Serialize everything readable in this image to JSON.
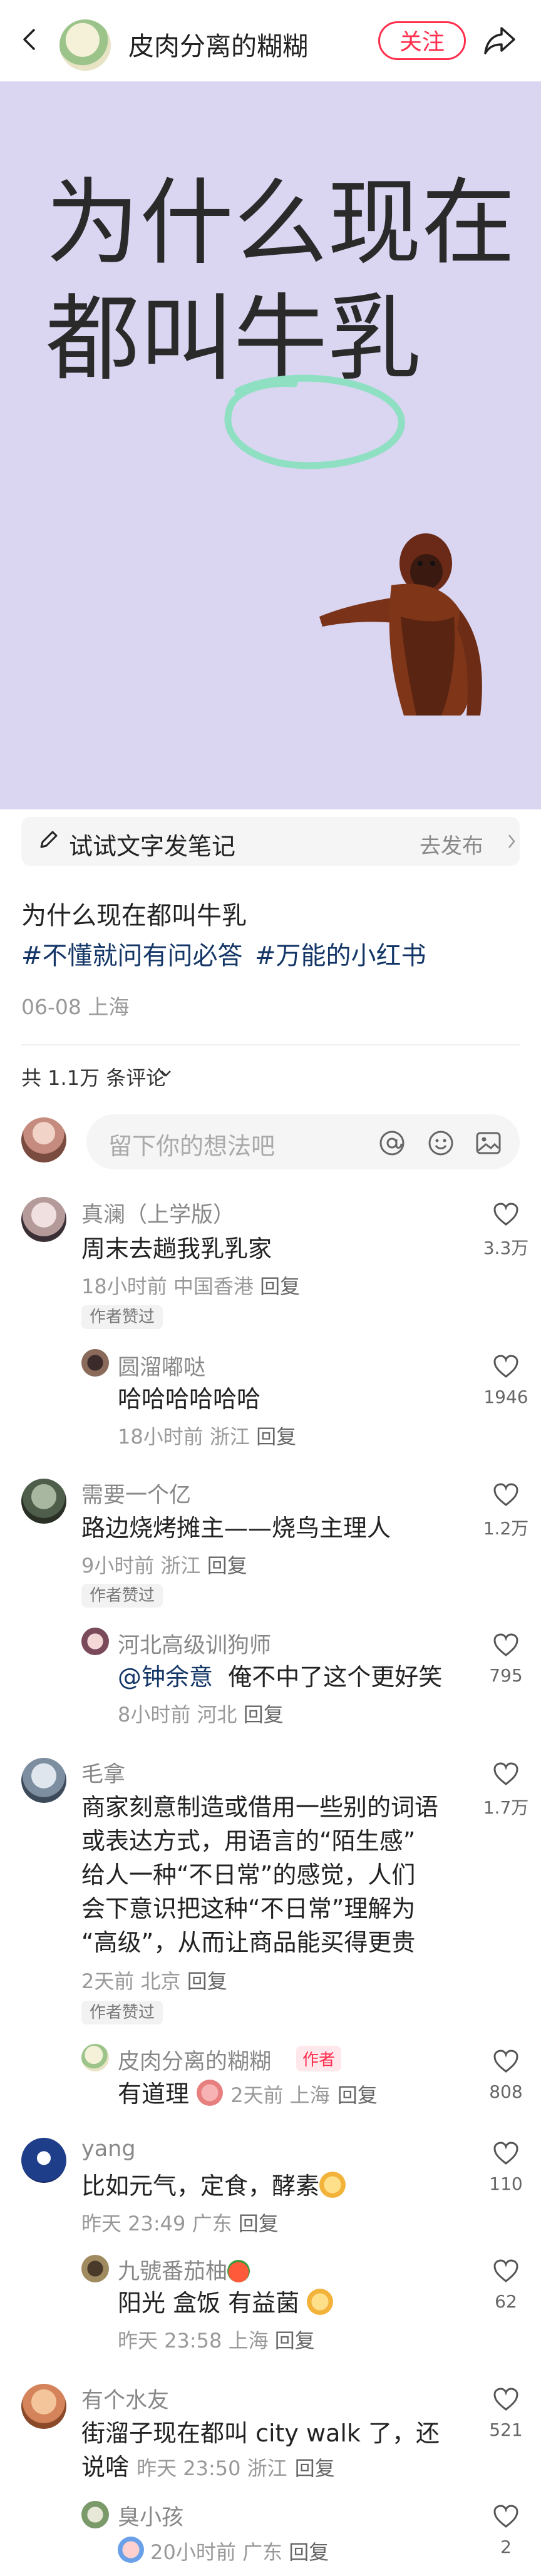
{
  "header": {
    "author_name": "皮肉分离的糊糊",
    "follow_label": "关注"
  },
  "post": {
    "image_headline": "为什么现在\n都叫牛乳",
    "editor_label": "试试文字发笔记",
    "publish_label": "去发布",
    "title": "为什么现在都叫牛乳",
    "tags": [
      "#不懂就问有问必答",
      "#万能的小红书"
    ],
    "date_location": "06-08 上海"
  },
  "comments_header": {
    "count_label": "共 1.1万 条评论"
  },
  "comment_input": {
    "placeholder": "留下你的想法吧"
  },
  "labels": {
    "reply": "回复",
    "author_liked": "作者赞过",
    "author": "作者"
  },
  "comments": [
    {
      "name": "真澜（上学版）",
      "text": "周末去趟我乳乳家",
      "time": "18小时前 中国香港",
      "likes": "3.3万",
      "author_liked": true,
      "replies": [
        {
          "name": "圆溜嘟哒",
          "text": "哈哈哈哈哈哈",
          "time": "18小时前 浙江",
          "likes": "1946"
        }
      ]
    },
    {
      "name": "需要一个亿",
      "text": "路边烧烤摊主——烧鸟主理人",
      "time": "9小时前 浙江",
      "likes": "1.2万",
      "author_liked": true,
      "replies": [
        {
          "name": "河北高级训狗师",
          "mention": "@钟余意",
          "text": "俺不中了这个更好笑",
          "time": "8小时前 河北",
          "likes": "795"
        }
      ]
    },
    {
      "name": "毛拿",
      "lines": [
        "商家刻意制造或借用一些别的词语",
        "或表达方式，用语言的“陌生感”",
        "给人一种“不日常”的感觉，人们",
        "会下意识把这种“不日常”理解为",
        "“高级”，从而让商品能买得更贵"
      ],
      "time": "2天前 北京",
      "likes": "1.7万",
      "author_liked": true,
      "replies": [
        {
          "name": "皮肉分离的糊糊",
          "is_author": true,
          "text": "有道理",
          "time": "2天前 上海",
          "likes": "808"
        }
      ]
    },
    {
      "name": "yang",
      "text": "比如元气，定食，酵素",
      "time": "昨天 23:49 广东",
      "likes": "110",
      "replies": [
        {
          "name": "九號番茄柚",
          "text": "阳光 盒饭 有益菌",
          "time": "昨天 23:58 上海",
          "likes": "62"
        }
      ]
    },
    {
      "name": "有个水友",
      "lines": [
        "街溜子现在都叫 city walk 了，还"
      ],
      "last_line": "说啥",
      "time": "昨天 23:50 浙江",
      "likes": "521",
      "replies": [
        {
          "name": "臭小孩",
          "text": "",
          "time": "20小时前 广东",
          "likes": "2"
        }
      ]
    }
  ],
  "colors": {
    "accent": "#ff2e4d",
    "tag_blue": "#133667",
    "image_bg": "#dad5f1",
    "circle_green": "#8fe0c2"
  },
  "icons": [
    "back-icon",
    "share-icon",
    "pencil-icon",
    "at-icon",
    "emoji-icon",
    "image-icon",
    "heart-icon",
    "chevron-down-icon",
    "chevron-right-icon"
  ]
}
